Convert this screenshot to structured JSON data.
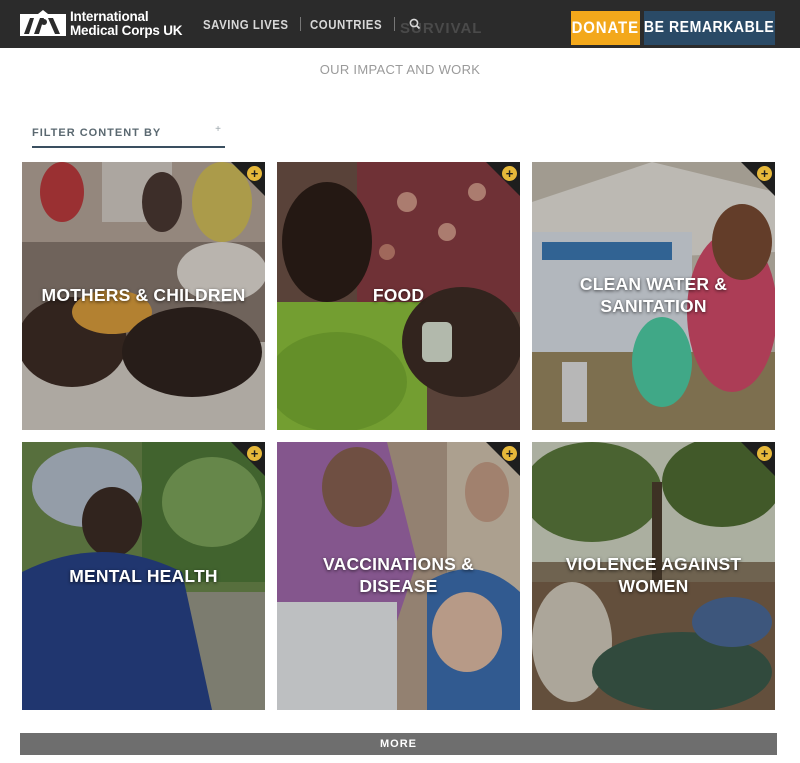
{
  "header": {
    "logo_text_line1": "International",
    "logo_text_line2": "Medical Corps UK",
    "nav": [
      "SAVING LIVES",
      "COUNTRIES"
    ],
    "search_icon": "search-icon",
    "ghost_text": "SURVIVAL",
    "donate_label": "DONATE",
    "remarkable_label": "BE REMARKABLE",
    "colors": {
      "bar": "#2b2b2b",
      "donate": "#f3a81b",
      "remarkable": "#2a4a66"
    }
  },
  "subtitle": "OUR IMPACT AND WORK",
  "filter": {
    "label": "FILTER CONTENT BY",
    "icon": "+"
  },
  "tiles": [
    {
      "label": "MOTHERS & CHILDREN"
    },
    {
      "label": "FOOD"
    },
    {
      "label": "CLEAN WATER & SANITATION"
    },
    {
      "label": "MENTAL HEALTH"
    },
    {
      "label": "VACCINATIONS & DISEASE"
    },
    {
      "label": "VIOLENCE AGAINST WOMEN"
    }
  ],
  "tile_icon": "+",
  "more_label": "MORE"
}
